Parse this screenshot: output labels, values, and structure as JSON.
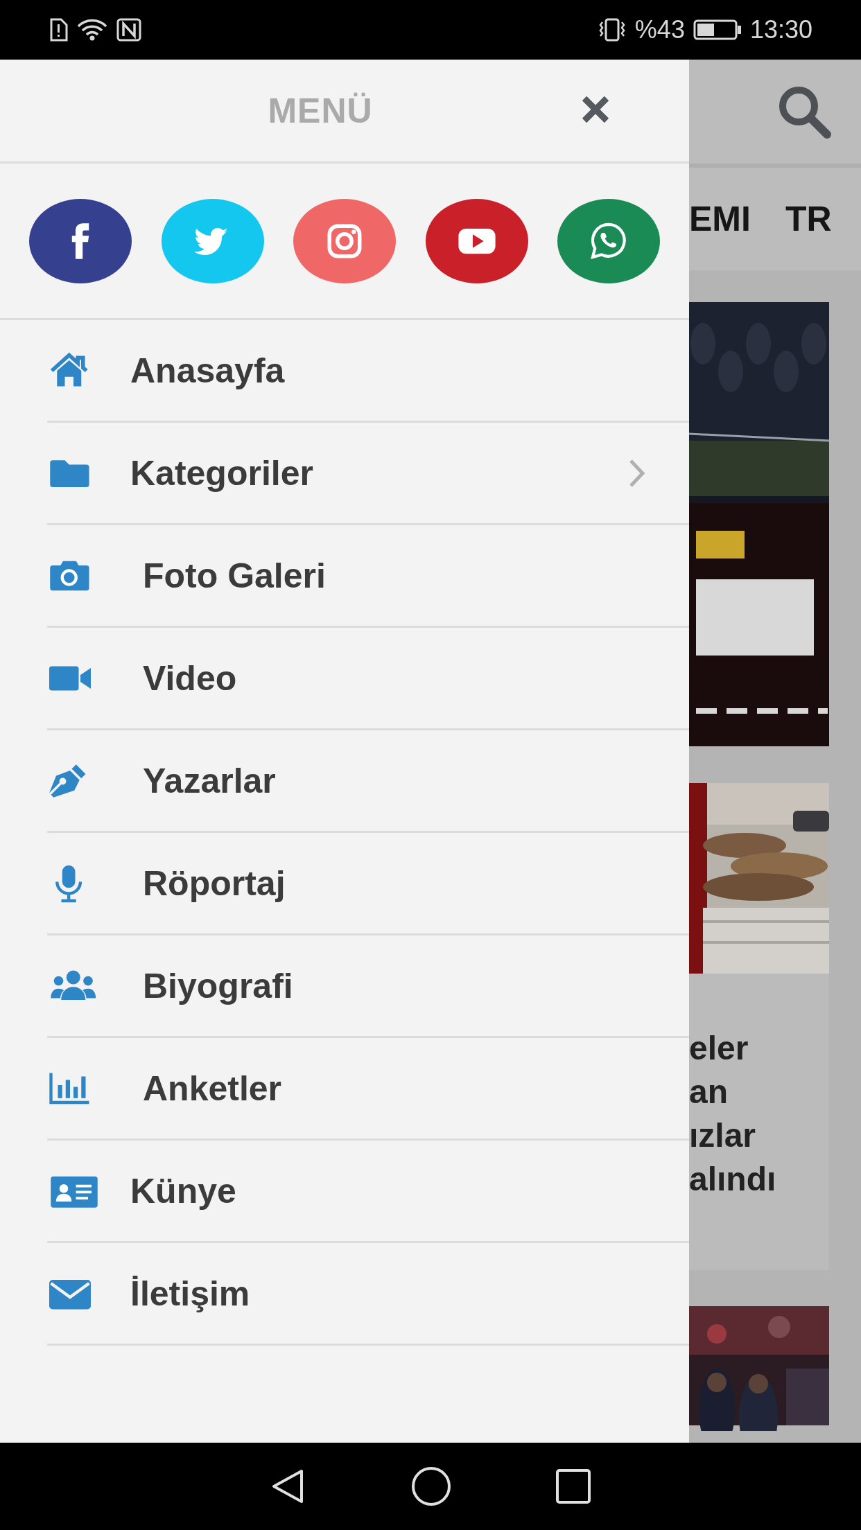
{
  "status_bar": {
    "battery": "%43",
    "time": "13:30"
  },
  "drawer": {
    "title": "MENÜ",
    "social": [
      {
        "color": "#35418f"
      },
      {
        "color": "#14c7ef"
      },
      {
        "color": "#f06767"
      },
      {
        "color": "#c9202a"
      },
      {
        "color": "#1b8b55"
      }
    ],
    "items": [
      {
        "label": "Anasayfa",
        "submenu": false
      },
      {
        "label": "Kategoriler",
        "submenu": true
      },
      {
        "label": "Foto Galeri",
        "submenu": false
      },
      {
        "label": "Video",
        "submenu": false
      },
      {
        "label": "Yazarlar",
        "submenu": false
      },
      {
        "label": "Röportaj",
        "submenu": false
      },
      {
        "label": "Biyografi",
        "submenu": false
      },
      {
        "label": "Anketler",
        "submenu": false
      },
      {
        "label": "Künye",
        "submenu": false
      },
      {
        "label": "İletişim",
        "submenu": false
      }
    ]
  },
  "page": {
    "tabs": [
      "EMI",
      "TR"
    ],
    "cards": [
      {
        "kind": "picture"
      },
      {
        "kind": "picture"
      },
      {
        "kind": "headline",
        "lines": [
          "eler",
          "an",
          "ızlar",
          "alındı"
        ]
      },
      {
        "kind": "picture"
      }
    ]
  }
}
